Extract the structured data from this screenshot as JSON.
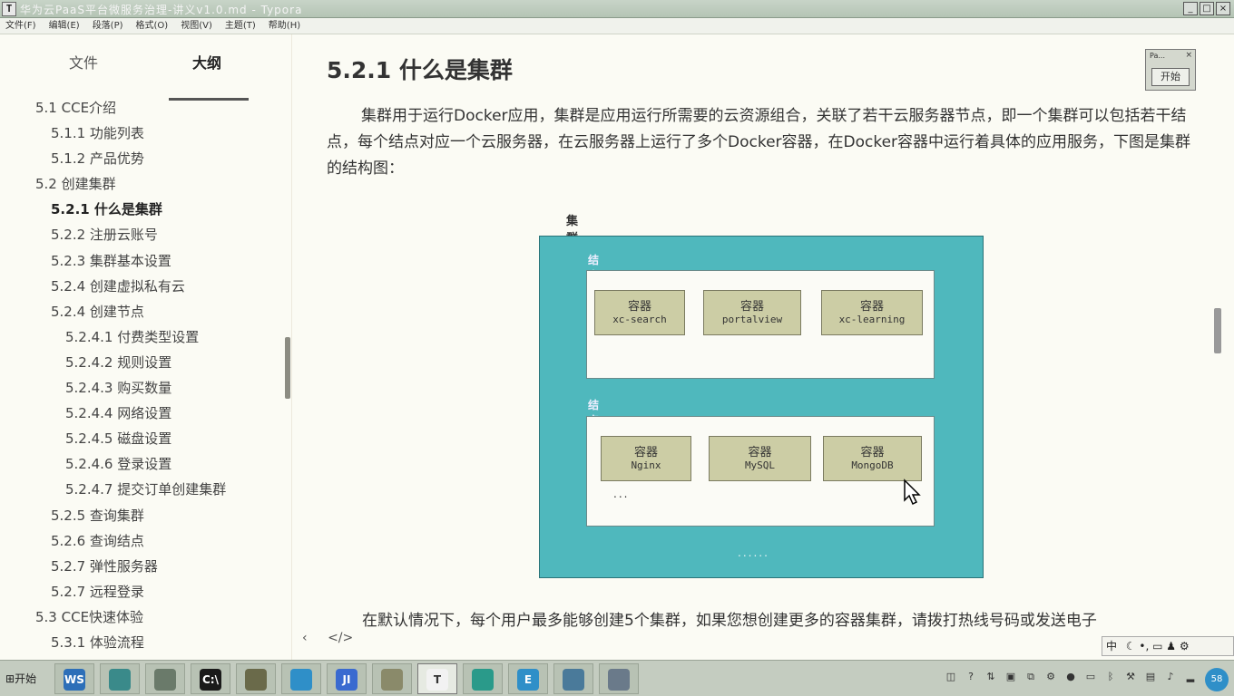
{
  "window": {
    "title": "华为云PaaS平台微服务治理-讲义v1.0.md - Typora",
    "buttons": [
      "_",
      "□",
      "×"
    ]
  },
  "menu": [
    "文件(F)",
    "编辑(E)",
    "段落(P)",
    "格式(O)",
    "视图(V)",
    "主题(T)",
    "帮助(H)"
  ],
  "sidebar": {
    "tabs": [
      "文件",
      "大纲"
    ],
    "items": [
      {
        "label": "5.1 CCE介绍"
      },
      {
        "label": "5.1.1 功能列表"
      },
      {
        "label": "5.1.2 产品优势"
      },
      {
        "label": "5.2 创建集群"
      },
      {
        "label": "5.2.1 什么是集群"
      },
      {
        "label": "5.2.2 注册云账号"
      },
      {
        "label": "5.2.3 集群基本设置"
      },
      {
        "label": "5.2.4 创建虚拟私有云"
      },
      {
        "label": "5.2.4 创建节点"
      },
      {
        "label": "5.2.4.1 付费类型设置"
      },
      {
        "label": "5.2.4.2 规则设置"
      },
      {
        "label": "5.2.4.3 购买数量"
      },
      {
        "label": "5.2.4.4 网络设置"
      },
      {
        "label": "5.2.4.5 磁盘设置"
      },
      {
        "label": "5.2.4.6 登录设置"
      },
      {
        "label": "5.2.4.7 提交订单创建集群"
      },
      {
        "label": "5.2.5 查询集群"
      },
      {
        "label": "5.2.6 查询结点"
      },
      {
        "label": "5.2.7 弹性服务器"
      },
      {
        "label": "5.2.7 远程登录"
      },
      {
        "label": "5.3 CCE快速体验"
      },
      {
        "label": "5.3.1 体验流程"
      }
    ]
  },
  "content": {
    "heading": "5.2.1 什么是集群",
    "paragraph": "集群用于运行Docker应用，集群是应用运行所需要的云资源组合，关联了若干云服务器节点，即一个集群可以包括若干结点，每个结点对应一个云服务器，在云服务器上运行了多个Docker容器，在Docker容器中运行着具体的应用服务，下图是集群的结构图：",
    "paragraph2": "在默认情况下，每个用户最多能够创建5个集群，如果您想创建更多的容器集群，请拨打热线号码或发送电子",
    "footer": [
      "‹",
      "</>"
    ]
  },
  "mini_window": {
    "title": "Pa...",
    "close": "×",
    "button": "开始"
  },
  "diagram": {
    "cluster_label": "集群",
    "nodes": [
      {
        "label": "结点",
        "containers": [
          {
            "title": "容器",
            "name": "xc-search"
          },
          {
            "title": "容器",
            "name": "portalview"
          },
          {
            "title": "容器",
            "name": "xc-learning"
          }
        ]
      },
      {
        "label": "结点",
        "containers": [
          {
            "title": "容器",
            "name": "Nginx"
          },
          {
            "title": "容器",
            "name": "MySQL"
          },
          {
            "title": "容器",
            "name": "MongoDB"
          }
        ],
        "more": "..."
      }
    ],
    "more": "......"
  },
  "taskbar": {
    "start": "开始",
    "apps": [
      {
        "name": "ws-icon",
        "label": "WS",
        "color": "#2d6fb8"
      },
      {
        "name": "bird-icon",
        "label": "",
        "color": "#3a8a8a"
      },
      {
        "name": "turtle-icon",
        "label": "",
        "color": "#6a7a6a"
      },
      {
        "name": "terminal-icon",
        "label": "C:\\",
        "color": "#1a1a1a"
      },
      {
        "name": "tools-icon",
        "label": "",
        "color": "#6a6a4a"
      },
      {
        "name": "qq-icon",
        "label": "",
        "color": "#2f8fc8"
      },
      {
        "name": "jetbrains-icon",
        "label": "JI",
        "color": "#3a6ad0"
      },
      {
        "name": "files-icon",
        "label": "",
        "color": "#8a8a6a"
      },
      {
        "name": "typora-icon",
        "label": "T",
        "color": "#f2f2f2"
      },
      {
        "name": "chrome-icon",
        "label": "",
        "color": "#2a9a8a"
      },
      {
        "name": "edit-icon",
        "label": "E",
        "color": "#2f8fc8"
      },
      {
        "name": "globe-icon",
        "label": "",
        "color": "#4a7a9a"
      },
      {
        "name": "satellite-icon",
        "label": "",
        "color": "#6a7a8a"
      }
    ],
    "clock": "58",
    "ime": "中"
  }
}
